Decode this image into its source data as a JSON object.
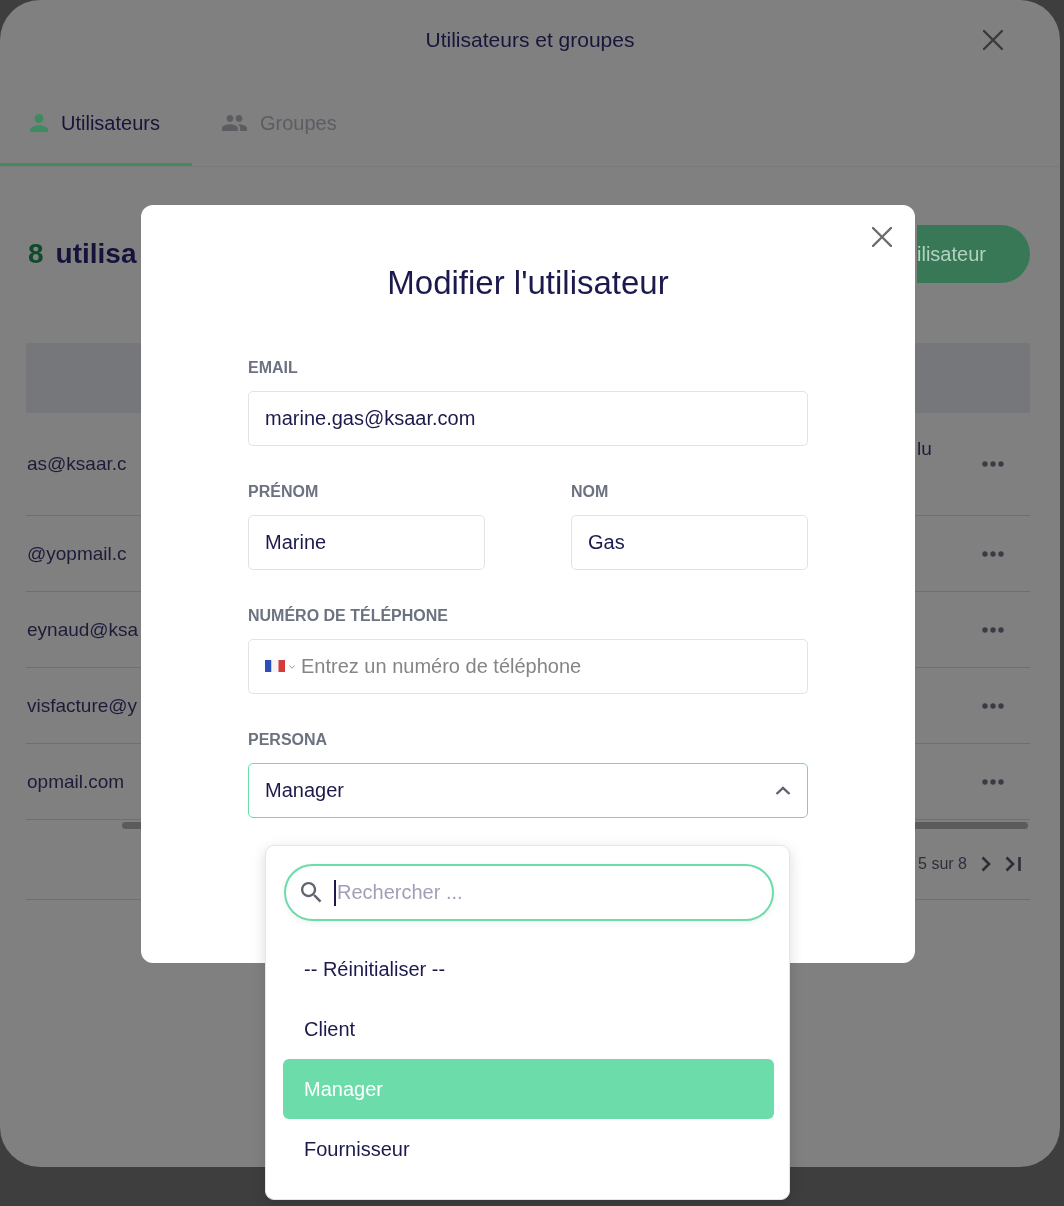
{
  "window": {
    "title": "Utilisateurs et groupes"
  },
  "tabs": [
    {
      "label": "Utilisateurs",
      "selected": true
    },
    {
      "label": "Groupes",
      "selected": false
    }
  ],
  "heading": {
    "count": "8",
    "text": "utilisa"
  },
  "primary_button": {
    "label": "ilisateur"
  },
  "table": {
    "rows": [
      {
        "column_1": "as@ksaar.c",
        "column_2": "lu"
      },
      {
        "column_1": "@yopmail.c"
      },
      {
        "column_1": "eynaud@ksa"
      },
      {
        "column_1": "visfacture@y"
      },
      {
        "column_1": "opmail.com"
      }
    ]
  },
  "pagination": {
    "range": "5 sur 8"
  },
  "modal": {
    "title": "Modifier l'utilisateur",
    "email": {
      "label": "EMAIL",
      "value": "marine.gas@ksaar.com"
    },
    "first_name": {
      "label": "PRÉNOM",
      "value": "Marine"
    },
    "last_name": {
      "label": "NOM",
      "value": "Gas"
    },
    "phone": {
      "label": "NUMÉRO DE TÉLÉPHONE",
      "placeholder": "Entrez un numéro de téléphone"
    },
    "persona": {
      "label": "PERSONA",
      "value": "Manager",
      "expanded": true,
      "dropdown": {
        "search": {
          "placeholder": "Rechercher ..."
        },
        "options": [
          {
            "label": "-- Réinitialiser --",
            "selected": false
          },
          {
            "label": "Client",
            "selected": false
          },
          {
            "label": "Manager",
            "selected": true
          },
          {
            "label": "Fournisseur",
            "selected": false
          }
        ]
      }
    }
  }
}
